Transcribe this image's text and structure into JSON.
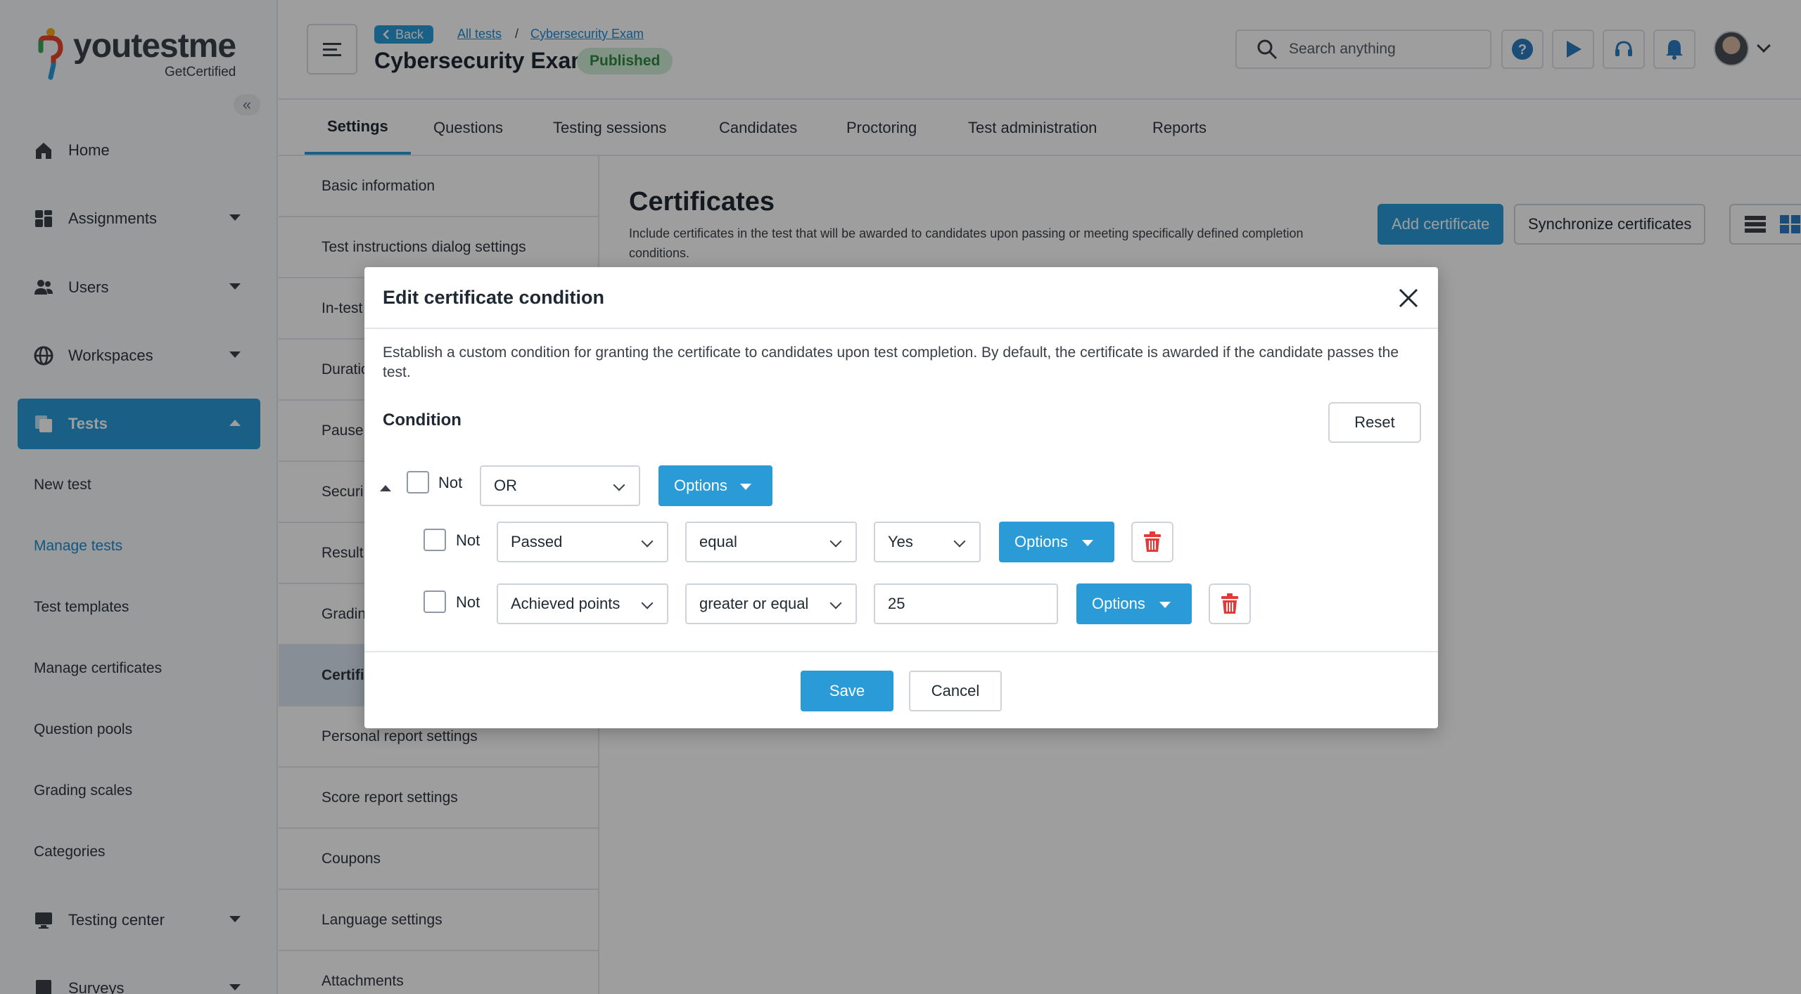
{
  "app": {
    "logo_text": "youtestme",
    "logo_sub": "GetCertified",
    "brand_color": "#2b9bd8"
  },
  "sidebar": {
    "items": [
      {
        "label": "Home",
        "icon": "home-icon"
      },
      {
        "label": "Assignments",
        "icon": "assignments-icon"
      },
      {
        "label": "Users",
        "icon": "users-icon"
      },
      {
        "label": "Workspaces",
        "icon": "globe-icon"
      },
      {
        "label": "Tests",
        "icon": "tests-icon"
      },
      {
        "label": "Testing center",
        "icon": "monitor-icon"
      },
      {
        "label": "Surveys",
        "icon": "surveys-icon"
      }
    ],
    "sub_items": [
      {
        "label": "New test"
      },
      {
        "label": "Manage tests"
      },
      {
        "label": "Test templates"
      },
      {
        "label": "Manage certificates"
      },
      {
        "label": "Question pools"
      },
      {
        "label": "Grading scales"
      },
      {
        "label": "Categories"
      }
    ]
  },
  "header": {
    "back_label": "Back",
    "breadcrumb": [
      "All tests",
      "Cybersecurity Exam"
    ],
    "breadcrumb_sep": "/",
    "title": "Cybersecurity Exam",
    "status": "Published",
    "search_placeholder": "Search anything"
  },
  "tabs": [
    {
      "label": "Settings"
    },
    {
      "label": "Questions"
    },
    {
      "label": "Testing sessions"
    },
    {
      "label": "Candidates"
    },
    {
      "label": "Proctoring"
    },
    {
      "label": "Test administration"
    },
    {
      "label": "Reports"
    }
  ],
  "settings_nav": [
    {
      "label": "Basic information"
    },
    {
      "label": "Test instructions dialog settings"
    },
    {
      "label": "In-test"
    },
    {
      "label": "Duratio"
    },
    {
      "label": "Pause,"
    },
    {
      "label": "Securi"
    },
    {
      "label": "Result"
    },
    {
      "label": "Gradin"
    },
    {
      "label": "Certifi"
    },
    {
      "label": "Personal report settings"
    },
    {
      "label": "Score report settings"
    },
    {
      "label": "Coupons"
    },
    {
      "label": "Language settings"
    },
    {
      "label": "Attachments"
    }
  ],
  "main": {
    "title": "Certificates",
    "description": "Include certificates in the test that will be awarded to candidates upon passing or meeting specifically defined completion conditions.",
    "add_button": "Add certificate",
    "sync_button": "Synchronize certificates"
  },
  "modal": {
    "title": "Edit certificate condition",
    "description": "Establish a custom condition for granting the certificate to candidates upon test completion. By default, the certificate is awarded if the candidate passes the test.",
    "condition_label": "Condition",
    "reset_label": "Reset",
    "group": {
      "not_label": "Not",
      "not_checked": false,
      "operator": "OR",
      "options_label": "Options"
    },
    "rows": [
      {
        "not_label": "Not",
        "not_checked": false,
        "field": "Passed",
        "comparator": "equal",
        "value": "Yes",
        "value_type": "select",
        "options_label": "Options"
      },
      {
        "not_label": "Not",
        "not_checked": false,
        "field": "Achieved points",
        "comparator": "greater or equal",
        "value": "25",
        "value_type": "input",
        "options_label": "Options"
      }
    ],
    "save_label": "Save",
    "cancel_label": "Cancel"
  }
}
